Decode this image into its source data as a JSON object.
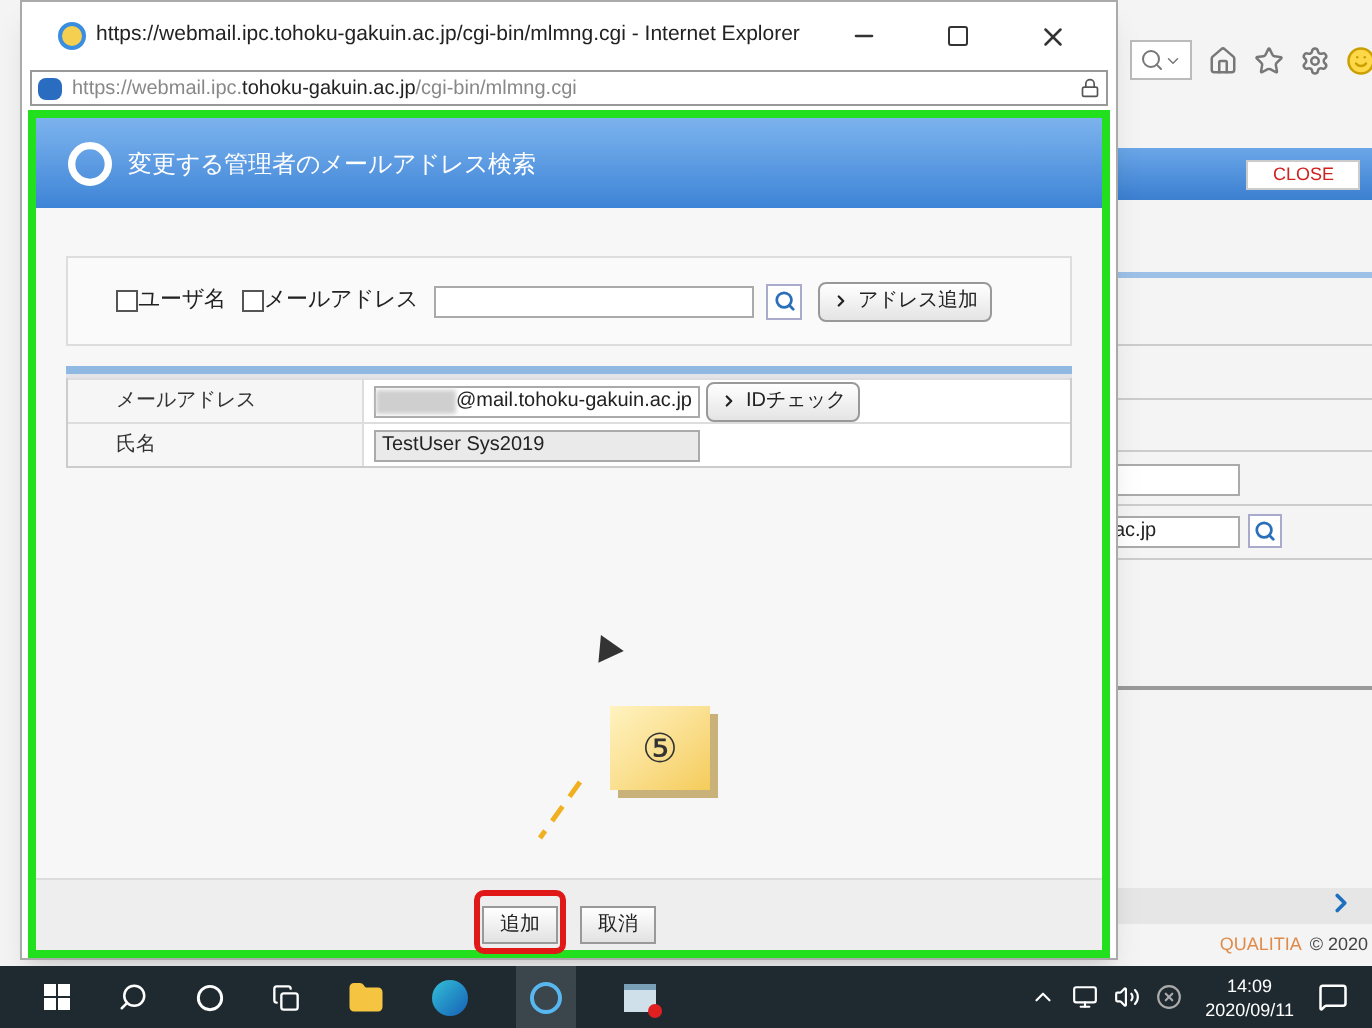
{
  "popup": {
    "title": "https://webmail.ipc.tohoku-gakuin.ac.jp/cgi-bin/mlmng.cgi - Internet Explorer",
    "url": "https://webmail.ipc.**tohoku-gakuin.ac.jp**/cgi-bin/mlmng.cgi"
  },
  "dialog": {
    "title": "変更する管理者のメールアドレス検索",
    "search": {
      "options": [
        {
          "label": "ユーザ名",
          "checked": false
        },
        {
          "label": "メールアドレス",
          "checked": false
        }
      ],
      "add_button": "アドレス追加"
    },
    "rows": [
      {
        "kind": "email",
        "label": "メールアドレス",
        "value": "@mail.tohoku-gakuin.ac.jp",
        "button": "IDチェック"
      },
      {
        "kind": "name",
        "label": "氏名",
        "value": "TestUser Sys2019"
      }
    ],
    "buttons": [
      {
        "label": "追加",
        "highlighted": true
      },
      {
        "label": "取消",
        "highlighted": false
      }
    ],
    "annotation": "⑤"
  },
  "background_page": {
    "close_button": "CLOSE",
    "field_value": "ac.jp",
    "brand": "QUALITIA",
    "copyright": "© 2020"
  },
  "taskbar": {
    "time": "14:09",
    "date": "2020/09/11"
  }
}
